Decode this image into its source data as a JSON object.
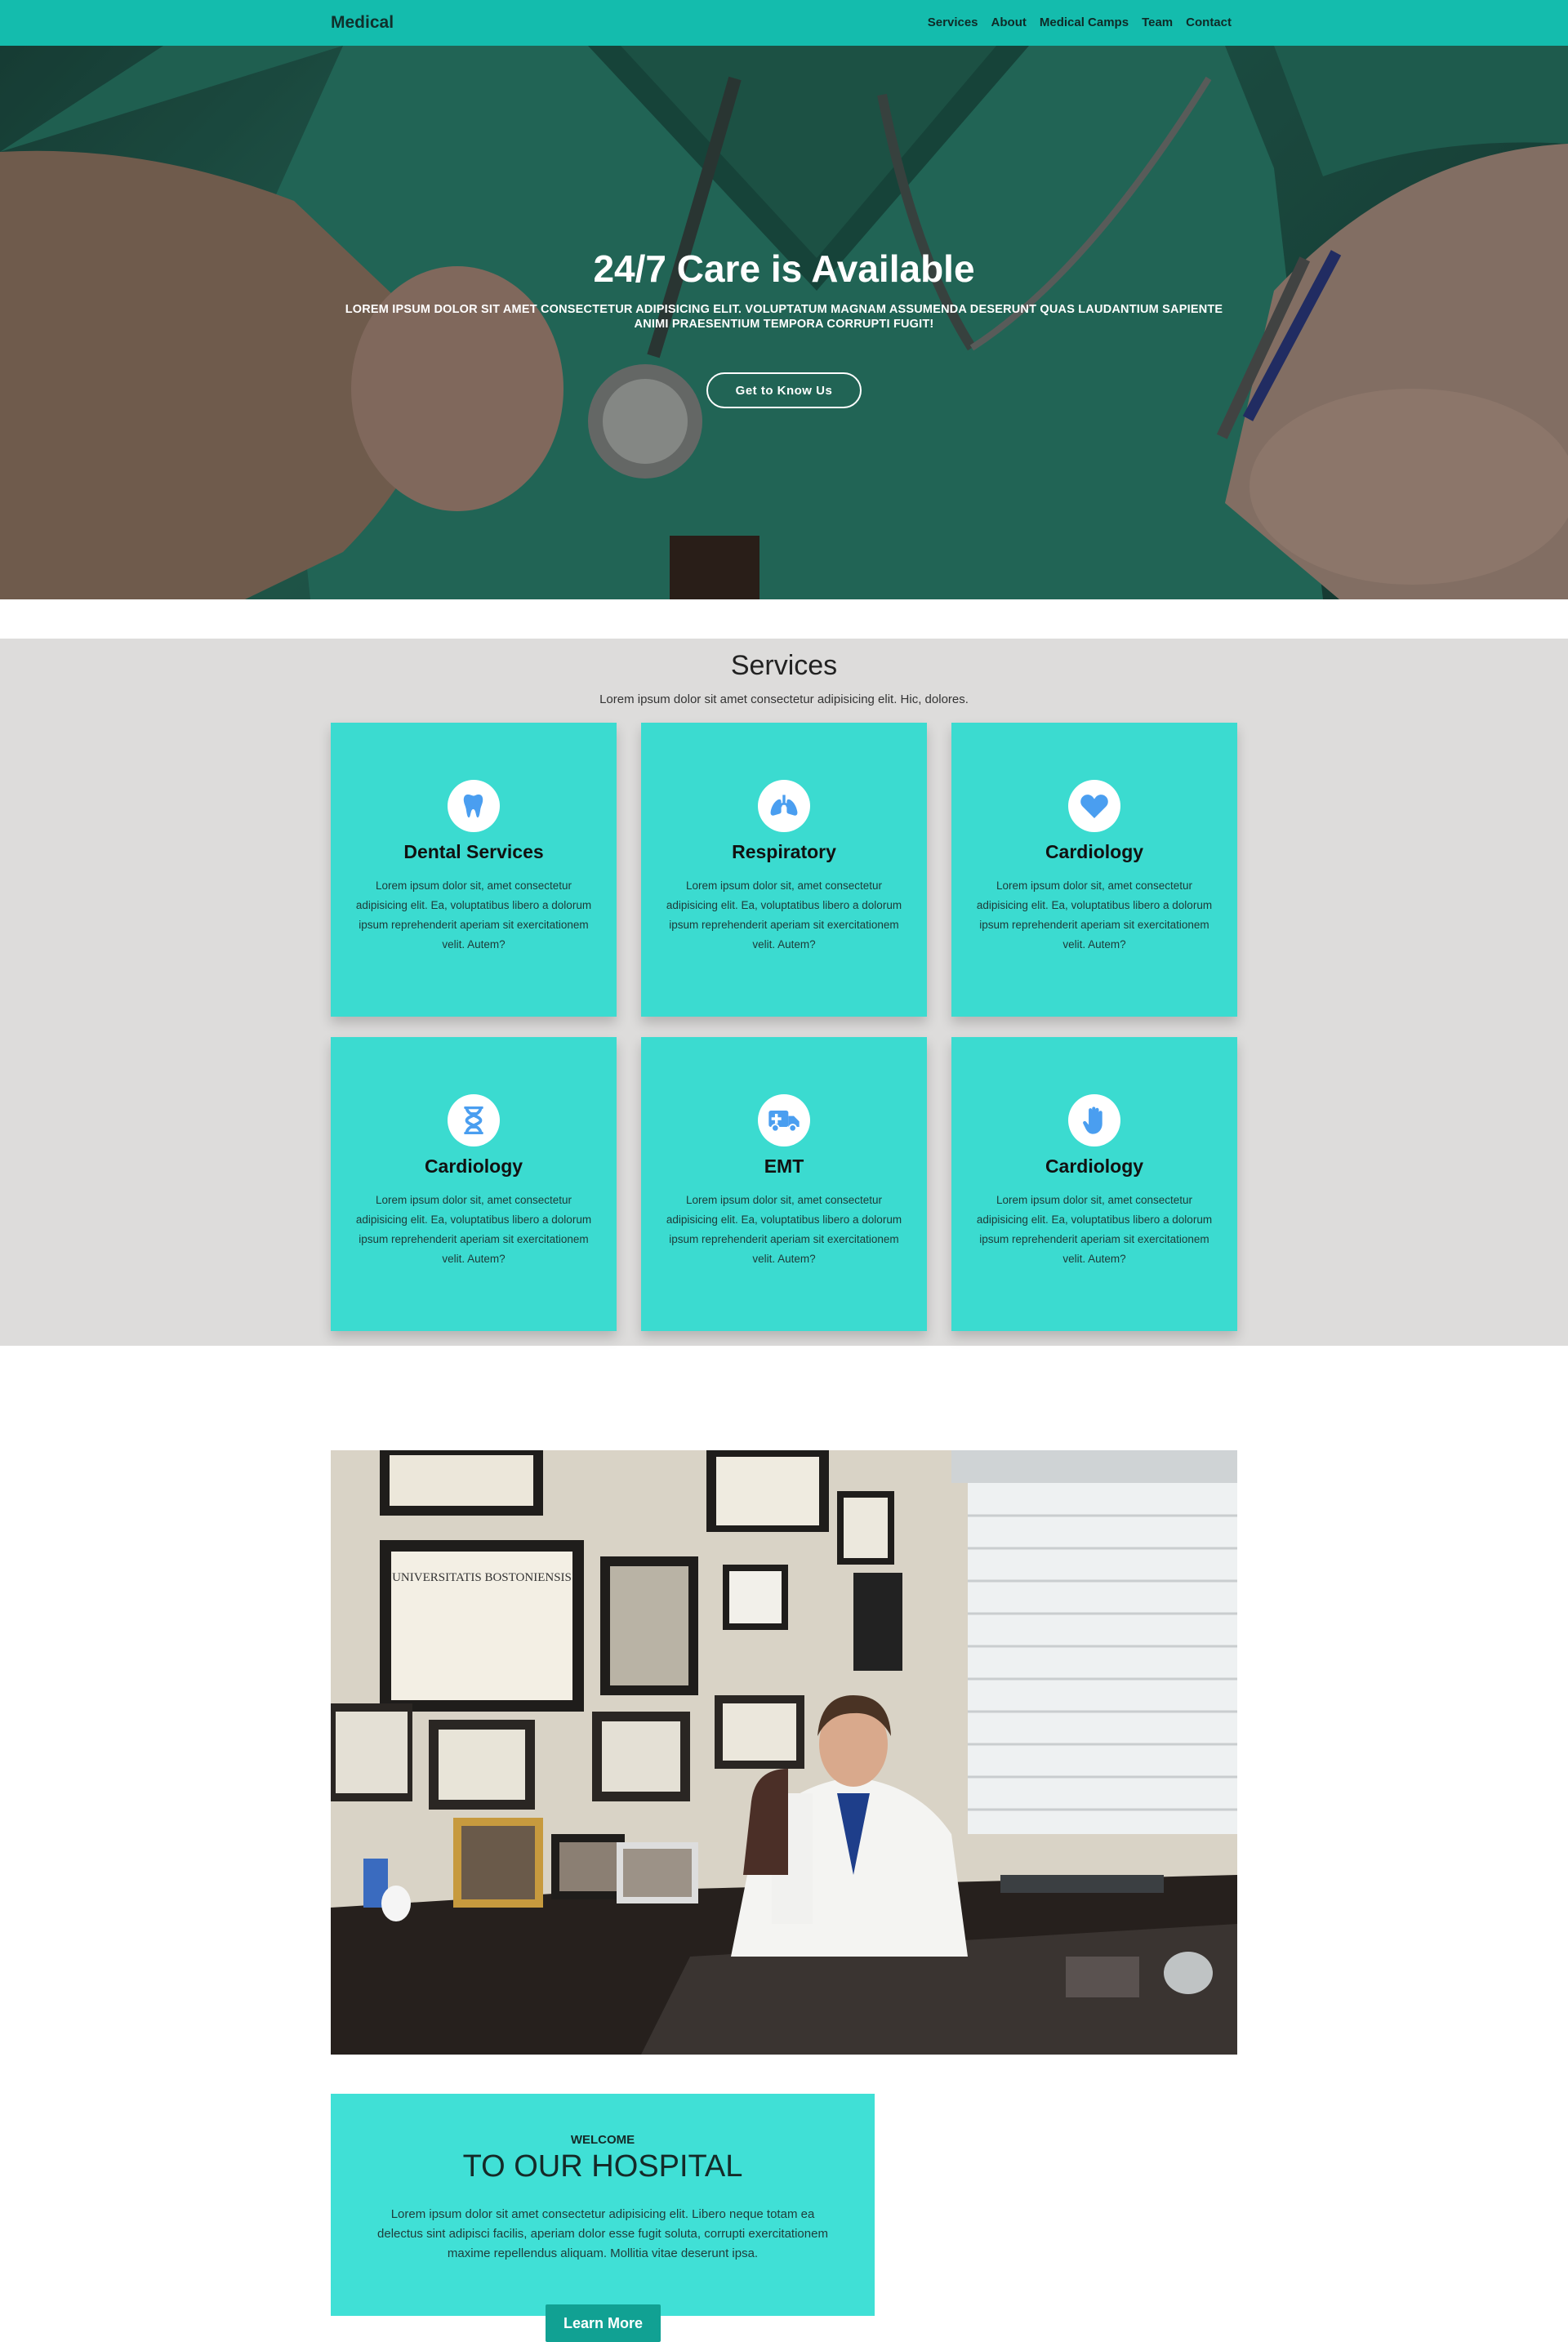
{
  "navbar": {
    "brand": "Medical",
    "links": [
      "Services",
      "About",
      "Medical Camps",
      "Team",
      "Contact"
    ]
  },
  "hero": {
    "title": "24/7 Care is Available",
    "subtitle": "LOREM IPSUM DOLOR SIT AMET CONSECTETUR ADIPISICING ELIT. VOLUPTATUM MAGNAM ASSUMENDA DESERUNT QUAS LAUDANTIUM SAPIENTE ANIMI PRAESENTIUM TEMPORA CORRUPTI FUGIT!",
    "button_label": "Get to Know Us"
  },
  "services": {
    "title": "Services",
    "subtitle": "Lorem ipsum dolor sit amet consectetur adipisicing elit. Hic, dolores.",
    "cards": [
      {
        "icon": "tooth-icon",
        "title": "Dental Services",
        "text": "Lorem ipsum dolor sit, amet consectetur adipisicing elit. Ea, voluptatibus libero a dolorum ipsum reprehenderit aperiam sit exercitationem velit. Autem?"
      },
      {
        "icon": "lungs-icon",
        "title": "Respiratory",
        "text": "Lorem ipsum dolor sit, amet consectetur adipisicing elit. Ea, voluptatibus libero a dolorum ipsum reprehenderit aperiam sit exercitationem velit. Autem?"
      },
      {
        "icon": "heart-icon",
        "title": "Cardiology",
        "text": "Lorem ipsum dolor sit, amet consectetur adipisicing elit. Ea, voluptatibus libero a dolorum ipsum reprehenderit aperiam sit exercitationem velit. Autem?"
      },
      {
        "icon": "dna-icon",
        "title": "Cardiology",
        "text": "Lorem ipsum dolor sit, amet consectetur adipisicing elit. Ea, voluptatibus libero a dolorum ipsum reprehenderit aperiam sit exercitationem velit. Autem?"
      },
      {
        "icon": "ambulance-icon",
        "title": "EMT",
        "text": "Lorem ipsum dolor sit, amet consectetur adipisicing elit. Ea, voluptatibus libero a dolorum ipsum reprehenderit aperiam sit exercitationem velit. Autem?"
      },
      {
        "icon": "hand-icon",
        "title": "Cardiology",
        "text": "Lorem ipsum dolor sit, amet consectetur adipisicing elit. Ea, voluptatibus libero a dolorum ipsum reprehenderit aperiam sit exercitationem velit. Autem?"
      }
    ]
  },
  "office_photo": {
    "diploma_text": "UNIVERSITATIS BOSTONIENSIS"
  },
  "welcome": {
    "label": "WELCOME",
    "title": "TO OUR HOSPITAL",
    "text": "Lorem ipsum dolor sit amet consectetur adipisicing elit. Libero neque totam ea delectus sint adipisci facilis, aperiam dolor esse fugit soluta, corrupti exercitationem maxime repellendus aliquam. Mollitia vitae deserunt ipsa.",
    "button_label": "Learn More"
  },
  "colors": {
    "navbar": "#14bcad",
    "card": "#3bdbd0",
    "icon": "#4a9ef0",
    "services_bg": "#dddcdb",
    "welcome_bg": "#40e0d6",
    "button": "#11a193"
  }
}
